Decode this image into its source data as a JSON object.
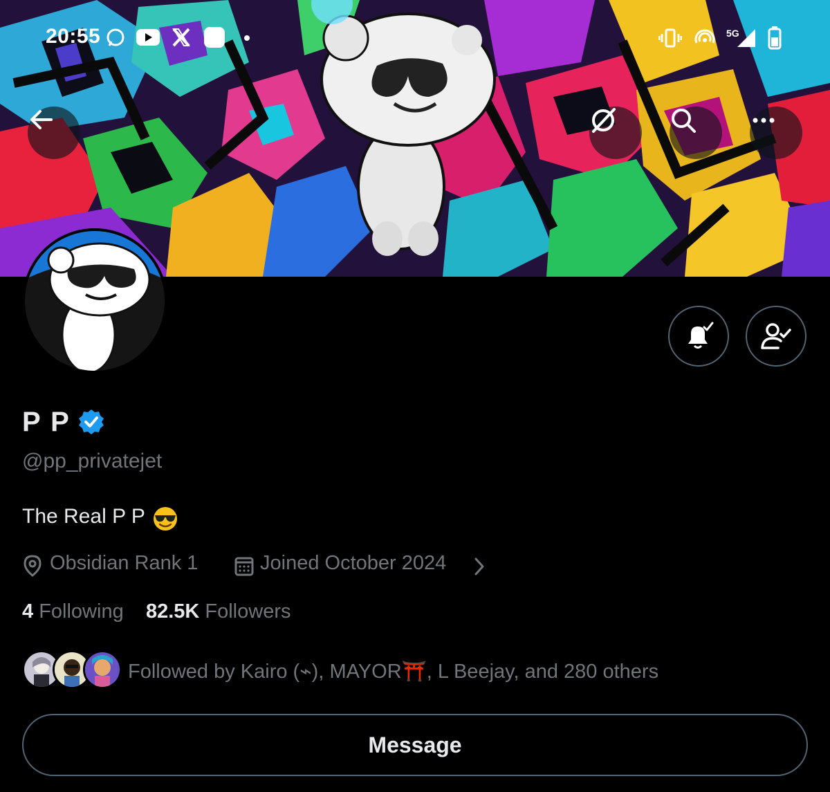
{
  "status_bar": {
    "time": "20:55",
    "network": "5G"
  },
  "header": {
    "back_icon": "arrow-left-icon",
    "grok_icon": "grok-icon",
    "search_icon": "search-icon",
    "more_icon": "more-horizontal-icon"
  },
  "profile": {
    "display_name": "P P",
    "verified": true,
    "handle": "@pp_privatejet",
    "bio": "The Real P P",
    "bio_emoji": "smiling-face-with-sunglasses",
    "location": "Obsidian Rank 1",
    "joined": "Joined October 2024",
    "following_count": "4",
    "following_label": "Following",
    "followers_count": "82.5K",
    "followers_label": "Followers",
    "followed_by": "Followed by Kairo (⌁), MAYOR⛩️, L Beejay, and 280 others"
  },
  "actions": {
    "notifications_icon": "bell-check-icon",
    "following_icon": "person-check-icon",
    "message_label": "Message"
  },
  "colors": {
    "background": "#000000",
    "text_primary": "#e7e9ea",
    "text_secondary": "#71767b",
    "border": "#536471",
    "verified_blue": "#1d9bf0"
  }
}
